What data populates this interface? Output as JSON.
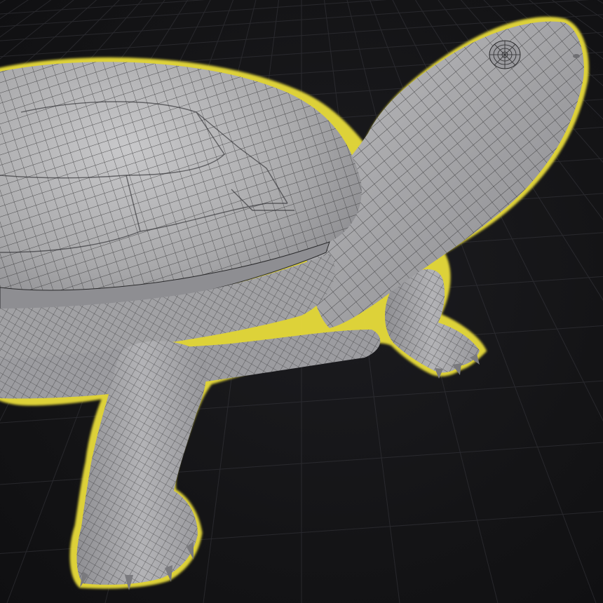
{
  "viewport": {
    "background_color": "#141416",
    "grid_color": "#3a3a40",
    "selection_outline_color": "#e8dc3a",
    "mesh_fill_color": "#a9a9ab",
    "wire_color": "#2a2a2c"
  },
  "scene": {
    "selected_object": "turtle-mesh",
    "display_mode": "wireframe-on-shaded"
  }
}
